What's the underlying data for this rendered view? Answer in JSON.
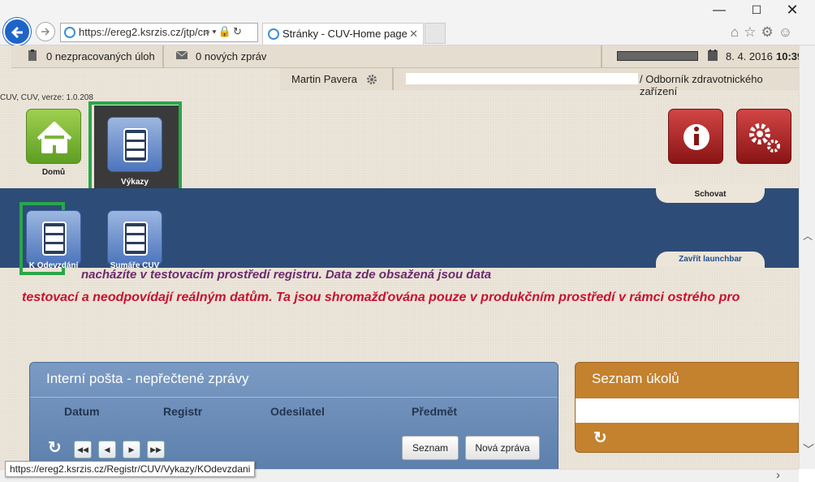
{
  "browser": {
    "address": "https://ereg2.ksrzis.cz/jtp/cn",
    "tab_title": "Stránky - CUV-Home page",
    "tab_close": "✕",
    "status_url": "https://ereg2.ksrzis.cz/Registr/CUV/Vykazy/KOdevzdani",
    "minimize": "—",
    "maximize": "☐",
    "close": "✕"
  },
  "topbar": {
    "tasks_label": "0 nezpracovaných úloh",
    "messages_label": "0 nových zpráv",
    "date": "8. 4. 2016",
    "time": "10:39"
  },
  "user": {
    "name": "Martin Pavera",
    "role": "/ Odborník zdravotnického zařízení"
  },
  "version": "CUV, CUV, verze: 1.0.208",
  "launchbar": {
    "home_label": "Domů",
    "reports_label": "Výkazy",
    "hide_label": "Schovat",
    "close_label": "Zavřít launchbar",
    "submit_label": "K Odevzdání",
    "summary_label": "Sumáře CUV"
  },
  "warning": {
    "line1": "nacházíte  v testovacím prostředí registru. Data zde obsažená jsou data",
    "line2": "testovací a neodpovídají reálným datům. Ta jsou shromažďována pouze v produkčním prostředí v rámci ostrého pro"
  },
  "mail_panel": {
    "title": "Interní pošta - nepřečtené zprávy",
    "columns": [
      "Datum",
      "Registr",
      "Odesilatel",
      "Předmět"
    ],
    "list_button": "Seznam",
    "new_button": "Nová zpráva"
  },
  "tasks_panel": {
    "title": "Seznam úkolů"
  }
}
